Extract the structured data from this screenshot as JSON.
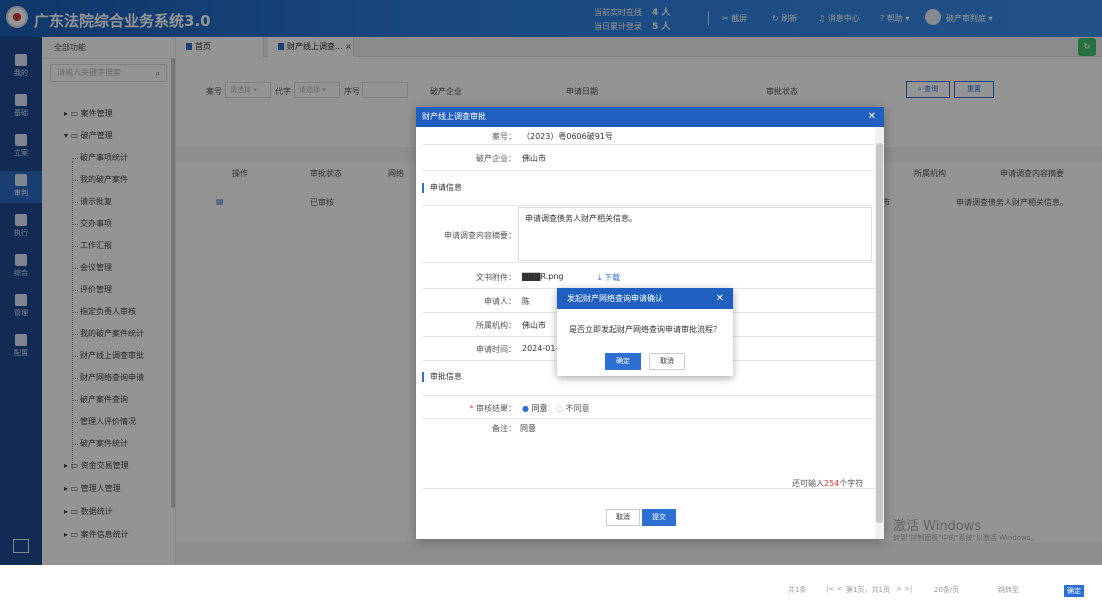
{
  "header": {
    "title": "广东法院综合业务系统3.0",
    "online_label": "当前实时在线",
    "online_count": "4 人",
    "login_label": "当日累计登录",
    "login_count": "5 人",
    "screenshot": "截屏",
    "refresh": "刷新",
    "messages": "消息中心",
    "help": "帮助",
    "user": "破产审判庭"
  },
  "rail": [
    {
      "label": "我的"
    },
    {
      "label": "基础"
    },
    {
      "label": "立案"
    },
    {
      "label": "审判"
    },
    {
      "label": "执行"
    },
    {
      "label": "综合"
    },
    {
      "label": "管理"
    },
    {
      "label": "配置"
    }
  ],
  "sidebar": {
    "header": "全部功能",
    "search_placeholder": "请输入关键字搜索",
    "groups": [
      "案件管理",
      "破产管理",
      "资金交易管理",
      "管理人管理",
      "数据统计",
      "案件信息统计"
    ],
    "subs": [
      "破产事项统计",
      "我的破产案件",
      "请示批复",
      "交办事项",
      "工作汇报",
      "会议管理",
      "评价管理",
      "指定负责人审核",
      "我的破产案件统计",
      "财产线上调查审批",
      "财产网络查询申请",
      "破产案件查询",
      "管理人评价情况",
      "破产案件统计"
    ]
  },
  "tabs": {
    "home": "首页",
    "current": "财产线上调查..."
  },
  "filter": {
    "case_no": "案号",
    "select_ph": "请选择",
    "code": "代字",
    "seq": "序号",
    "company": "破产企业",
    "apply_date": "申请日期",
    "approve_status": "审批状态",
    "query": "查询",
    "reset": "重置"
  },
  "grid": {
    "headers": [
      "操作",
      "审批状态",
      "网络",
      "所属机构",
      "申请调查内容摘要"
    ],
    "row": {
      "status": "已审核",
      "org": "佛山市",
      "summary": "申请调查债务人财产相关信息。"
    }
  },
  "pager": {
    "total": "共1条",
    "page": "第1页，共1页",
    "size": "20条/页",
    "goto": "跳转至",
    "ok": "确定"
  },
  "watermark": {
    "line1": "激活 Windows",
    "line2": "转到\"控制面板\"中的\"系统\"以激活 Windows。"
  },
  "dialog": {
    "title": "财产线上调查审批",
    "case_label": "案号：",
    "case_value": "（2023）粤0606破91号",
    "company_label": "破产企业：",
    "company_value": "佛山市",
    "sec_apply": "申请信息",
    "summary_label": "申请调查内容摘要：",
    "summary_value": "申请调查债务人财产相关信息。",
    "attach_label": "文书附件：",
    "attach_value": "R.png",
    "download": "下载",
    "applicant_label": "申请人：",
    "applicant_value": "陈",
    "org_label": "所属机构：",
    "org_value": "佛山市",
    "time_label": "申请时间：",
    "time_value": "2024-01-07",
    "sec_approve": "审批信息",
    "result_label": "审核结果：",
    "agree": "同意",
    "disagree": "不同意",
    "remark_label": "备注：",
    "remark_value": "同意",
    "remain_prefix": "还可输入",
    "remain_count": "254",
    "remain_suffix": "个字符",
    "cancel": "取消",
    "submit": "提交"
  },
  "confirm": {
    "title": "发起财产网络查询申请确认",
    "message": "是否立即发起财产网络查询申请审批流程？",
    "ok": "确定",
    "cancel": "取消"
  }
}
